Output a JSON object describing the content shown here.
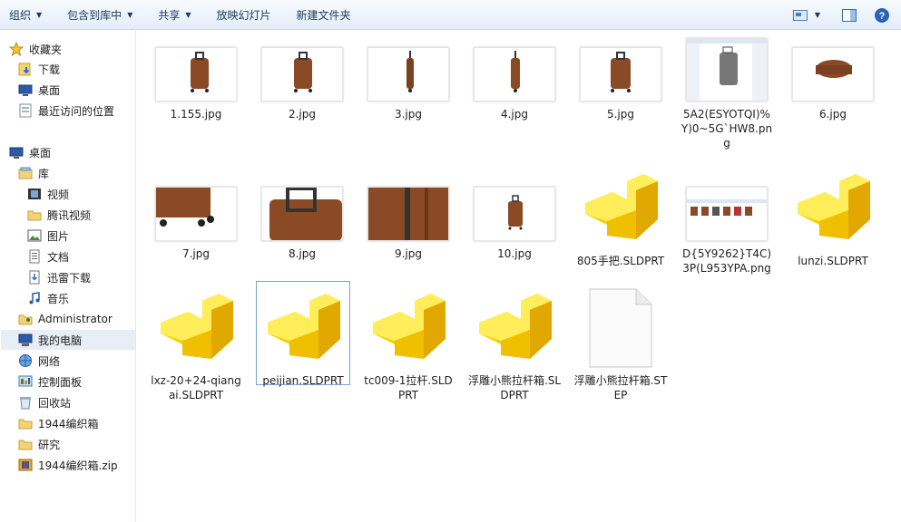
{
  "toolbar": {
    "organize": "组织",
    "include_library": "包含到库中",
    "share": "共享",
    "slideshow": "放映幻灯片",
    "new_folder": "新建文件夹"
  },
  "sidebar": {
    "favorites": "收藏夹",
    "downloads": "下载",
    "desktop_fav": "桌面",
    "recent": "最近访问的位置",
    "desktop": "桌面",
    "libraries": "库",
    "video": "视频",
    "tencent_video": "腾讯视频",
    "pictures": "图片",
    "documents": "文档",
    "xunlei": "迅雷下载",
    "music": "音乐",
    "administrator": "Administrator",
    "computer": "我的电脑",
    "network": "网络",
    "control_panel": "控制面板",
    "recycle": "回收站",
    "folder_1944": "1944编织箱",
    "research": "研究",
    "zip_1944": "1944编织箱.zip"
  },
  "files": [
    {
      "name": "1.155.jpg"
    },
    {
      "name": "2.jpg"
    },
    {
      "name": "3.jpg"
    },
    {
      "name": "4.jpg"
    },
    {
      "name": "5.jpg"
    },
    {
      "name": "5A2(ESYOTQI)%Y)0~5G`HW8.png"
    },
    {
      "name": "6.jpg"
    },
    {
      "name": "7.jpg"
    },
    {
      "name": "8.jpg"
    },
    {
      "name": "9.jpg"
    },
    {
      "name": "10.jpg"
    },
    {
      "name": "805手把.SLDPRT"
    },
    {
      "name": "D{5Y9262}T4C)3P(L953YPA.png"
    },
    {
      "name": "lunzi.SLDPRT"
    },
    {
      "name": "lxz-20+24-qiangai.SLDPRT"
    },
    {
      "name": "peijian.SLDPRT"
    },
    {
      "name": "tc009-1拉杆.SLDPRT"
    },
    {
      "name": "浮雕小熊拉杆箱.SLDPRT"
    },
    {
      "name": "浮雕小熊拉杆箱.STEP"
    }
  ]
}
